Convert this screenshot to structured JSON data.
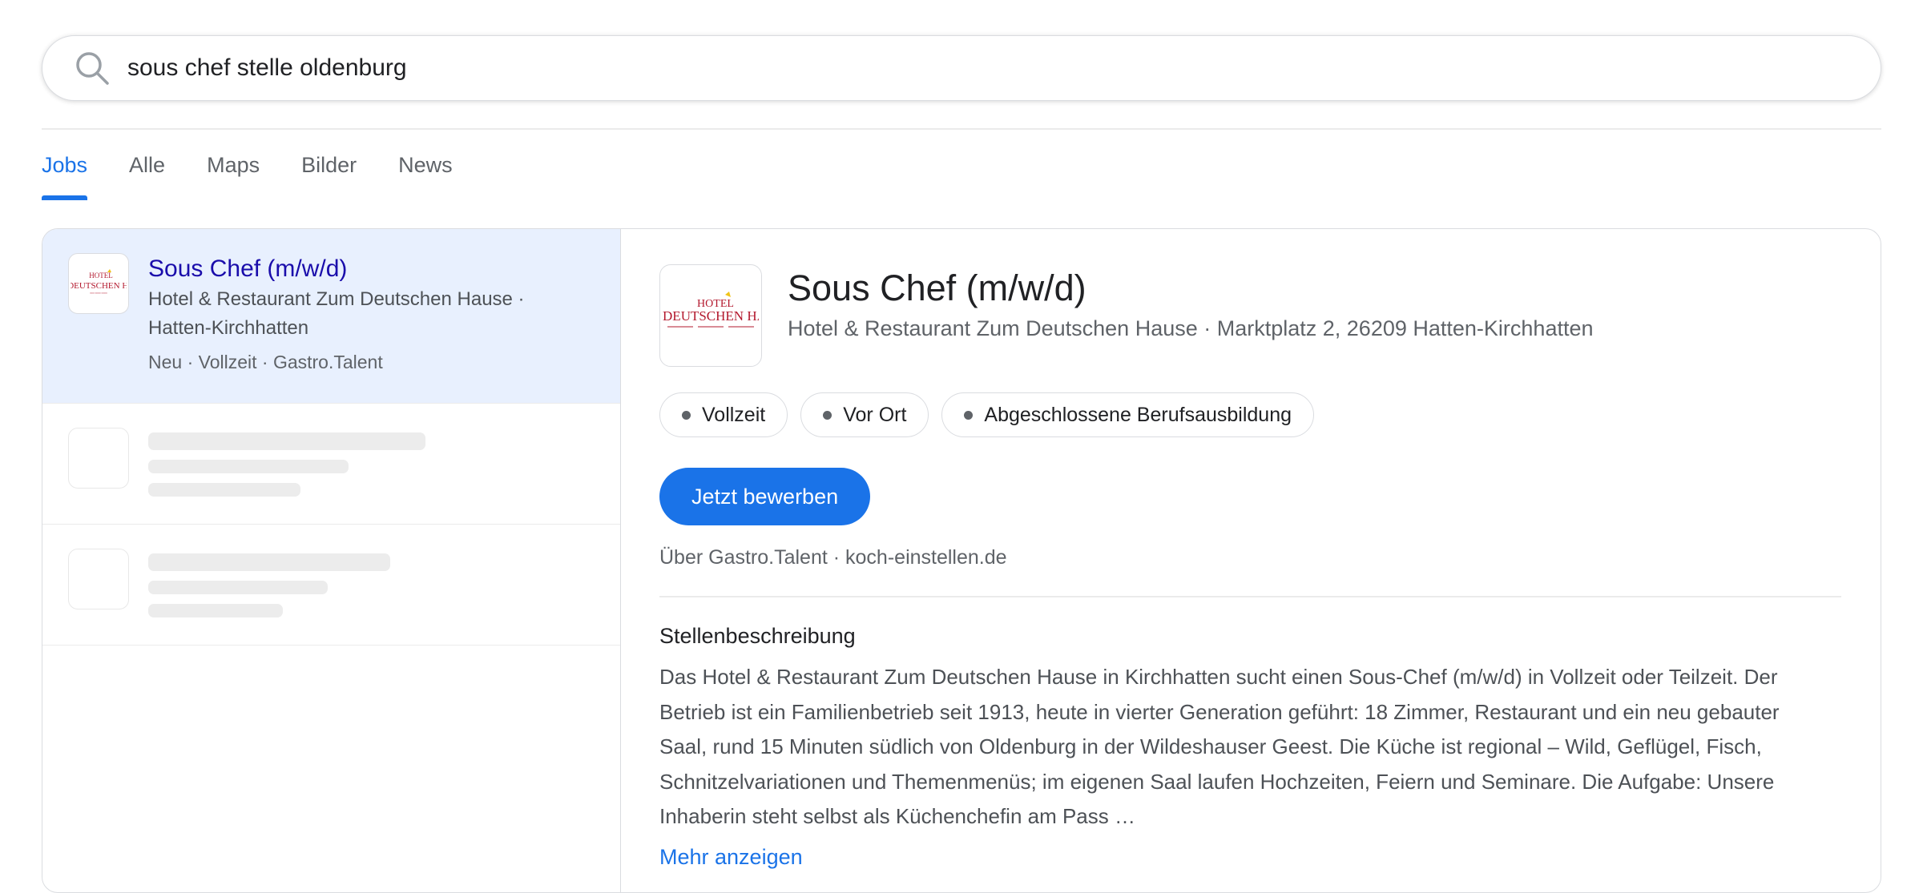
{
  "search": {
    "query": "sous chef stelle oldenburg"
  },
  "tabs": [
    {
      "label": "Jobs",
      "active": true
    },
    {
      "label": "Alle",
      "active": false
    },
    {
      "label": "Maps",
      "active": false
    },
    {
      "label": "Bilder",
      "active": false
    },
    {
      "label": "News",
      "active": false
    }
  ],
  "job_list": {
    "selected": {
      "title": "Sous Chef (m/w/d)",
      "company_line1": "Hotel & Restaurant Zum Deutschen Hause ·",
      "company_line2": "Hatten-Kirchhatten",
      "meta": "Neu · Vollzeit · Gastro.Talent",
      "logo_text": "Hotel Zum Deutschen Hause"
    }
  },
  "detail": {
    "title": "Sous Chef (m/w/d)",
    "subtitle": "Hotel & Restaurant Zum Deutschen Hause · Marktplatz 2, 26209 Hatten-Kirchhatten",
    "chips": [
      "Vollzeit",
      "Vor Ort",
      "Abgeschlossene Berufsausbildung"
    ],
    "apply_label": "Jetzt bewerben",
    "source": "Über Gastro.Talent · koch-einstellen.de",
    "section_heading": "Stellenbeschreibung",
    "description": "Das Hotel & Restaurant Zum Deutschen Hause in Kirchhatten sucht einen Sous-Chef (m/w/d) in Vollzeit oder Teilzeit. Der Betrieb ist ein Familienbetrieb seit 1913, heute in vierter Generation geführt: 18 Zimmer, Restaurant und ein neu gebauter Saal, rund 15 Minuten südlich von Oldenburg in der Wildeshauser Geest. Die Küche ist regional – Wild, Geflügel, Fisch, Schnitzelvariationen und Themenmenüs; im eigenen Saal laufen Hochzeiten, Feiern und Seminare. Die Aufgabe: Unsere Inhaberin steht selbst als Küchenchefin am Pass …",
    "more_label": "Mehr anzeigen"
  },
  "colors": {
    "accent": "#1a73e8",
    "title_link": "#1a0dab",
    "selected_bg": "#e8f0fe",
    "logo_red": "#b3182d",
    "logo_yellow": "#f0c419"
  }
}
